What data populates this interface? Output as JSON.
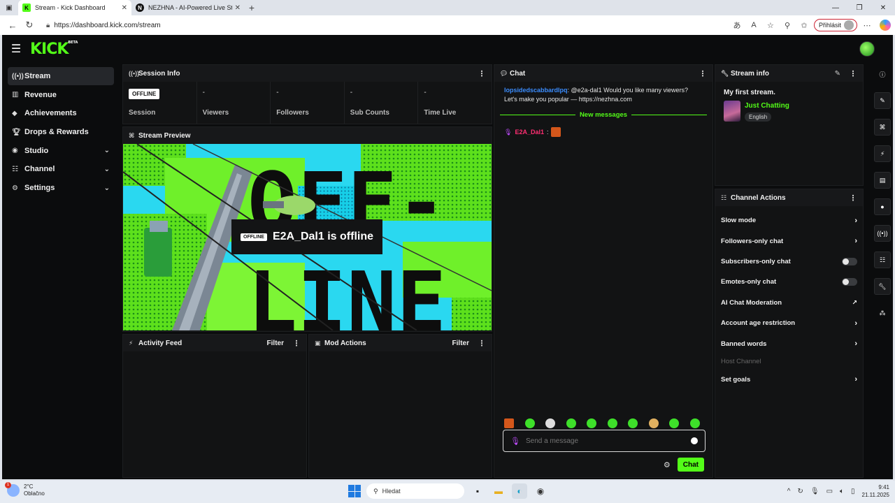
{
  "browser": {
    "tabs": [
      {
        "title": "Stream - Kick Dashboard",
        "active": true,
        "fav": "K"
      },
      {
        "title": "NEZHNA - AI-Powered Live Strea",
        "active": false,
        "fav": "N"
      }
    ],
    "url": "https://dashboard.kick.com/stream",
    "signin_label": "Přihlásit"
  },
  "app": {
    "logo": "KICK",
    "logo_badge": "BETA"
  },
  "sidenav": {
    "items": [
      {
        "label": "Stream",
        "icon": "broadcast-icon",
        "active": true,
        "expandable": false
      },
      {
        "label": "Revenue",
        "icon": "revenue-icon",
        "active": false,
        "expandable": false
      },
      {
        "label": "Achievements",
        "icon": "achievements-icon",
        "active": false,
        "expandable": false
      },
      {
        "label": "Drops & Rewards",
        "icon": "trophy-icon",
        "active": false,
        "expandable": false
      },
      {
        "label": "Studio",
        "icon": "studio-icon",
        "active": false,
        "expandable": true
      },
      {
        "label": "Channel",
        "icon": "channel-icon",
        "active": false,
        "expandable": true
      },
      {
        "label": "Settings",
        "icon": "gear-icon",
        "active": false,
        "expandable": true
      }
    ]
  },
  "session": {
    "title": "Session Info",
    "badge": "OFFLINE",
    "cells": [
      {
        "value": "",
        "label": "Session"
      },
      {
        "value": "-",
        "label": "Viewers"
      },
      {
        "value": "-",
        "label": "Followers"
      },
      {
        "value": "-",
        "label": "Sub Counts"
      },
      {
        "value": "-",
        "label": "Time Live"
      }
    ]
  },
  "preview": {
    "title": "Stream Preview",
    "badge": "OFFLINE",
    "offline_text": "E2A_Dal1 is offline",
    "art_line1": "OFF-",
    "art_line2": "LINE"
  },
  "activity": {
    "title": "Activity Feed",
    "filter": "Filter"
  },
  "mod": {
    "title": "Mod Actions",
    "filter": "Filter"
  },
  "chat": {
    "title": "Chat",
    "message": {
      "user": "lopsidedscabbardlpq",
      "text": ": @e2a-dal1 Would you like many viewers? Let's make you popular — https://nezhna.com"
    },
    "new_messages": "New messages",
    "user2": "E2A_Dal1",
    "placeholder": "Send a message",
    "send_label": "Chat"
  },
  "stream_info": {
    "title": "Stream info",
    "stream_title": "My first stream.",
    "category": "Just Chatting",
    "tag": "English"
  },
  "channel_actions": {
    "title": "Channel Actions",
    "items": [
      {
        "label": "Slow mode",
        "kind": "chevron"
      },
      {
        "label": "Followers-only chat",
        "kind": "chevron"
      },
      {
        "label": "Subscribers-only chat",
        "kind": "toggle"
      },
      {
        "label": "Emotes-only chat",
        "kind": "toggle"
      },
      {
        "label": "AI Chat Moderation",
        "kind": "external"
      },
      {
        "label": "Account age restriction",
        "kind": "chevron"
      },
      {
        "label": "Banned words",
        "kind": "chevron"
      },
      {
        "label": "Host Channel",
        "kind": "disabled"
      },
      {
        "label": "Set goals",
        "kind": "chevron"
      }
    ]
  },
  "taskbar": {
    "temp": "2°C",
    "weather": "Oblačno",
    "search": "Hledat",
    "time": "9:41",
    "date": "21.11.2025"
  },
  "colors": {
    "accent": "#53fc18",
    "bg": "#0b0c0d",
    "panel": "#121314"
  }
}
